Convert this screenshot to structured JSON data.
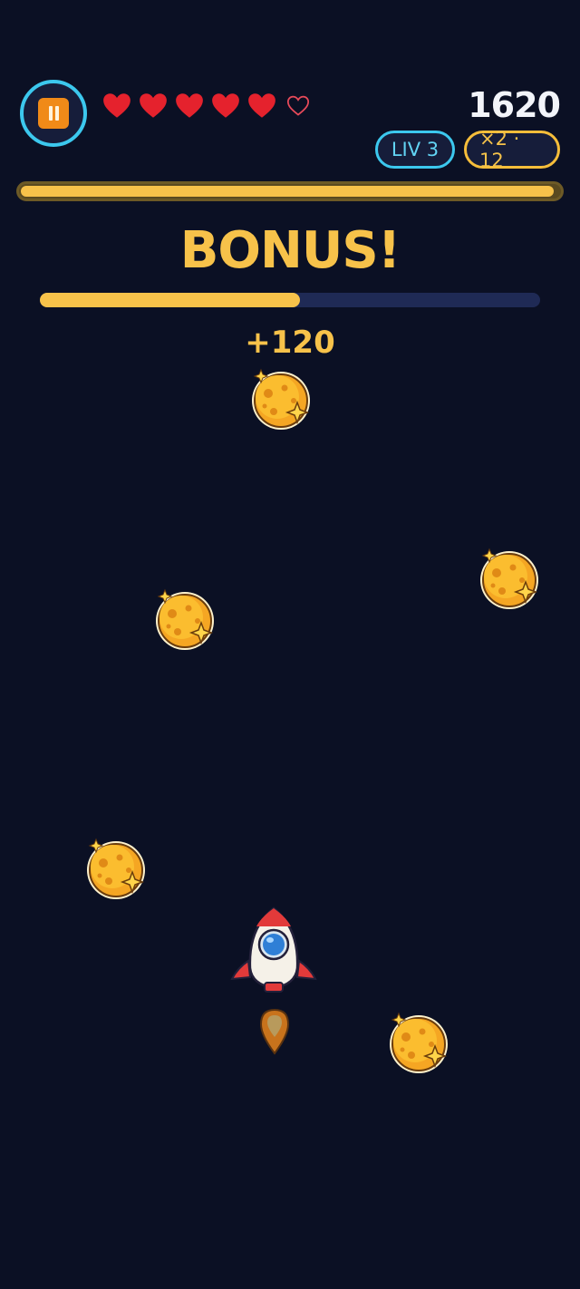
{
  "hud": {
    "pause_icon": "pause-icon",
    "lives_total": 6,
    "lives_full": 5,
    "score": "1620",
    "level_label": "LIV 3",
    "combo_label": "×2 · 12",
    "energy_fraction": 0.99
  },
  "bonus": {
    "title": "BONUS!",
    "progress_fraction": 0.52,
    "points_popup": "+120"
  },
  "colors": {
    "background": "#0b1024",
    "accent_cyan": "#3cc8ee",
    "accent_gold": "#f7c24a",
    "heart_red": "#e5222d",
    "pause_orange": "#f08a18"
  },
  "sprites": {
    "collectible": "golden-planet-icon",
    "player": "rocket-icon",
    "thruster": "thruster-flame-icon"
  }
}
